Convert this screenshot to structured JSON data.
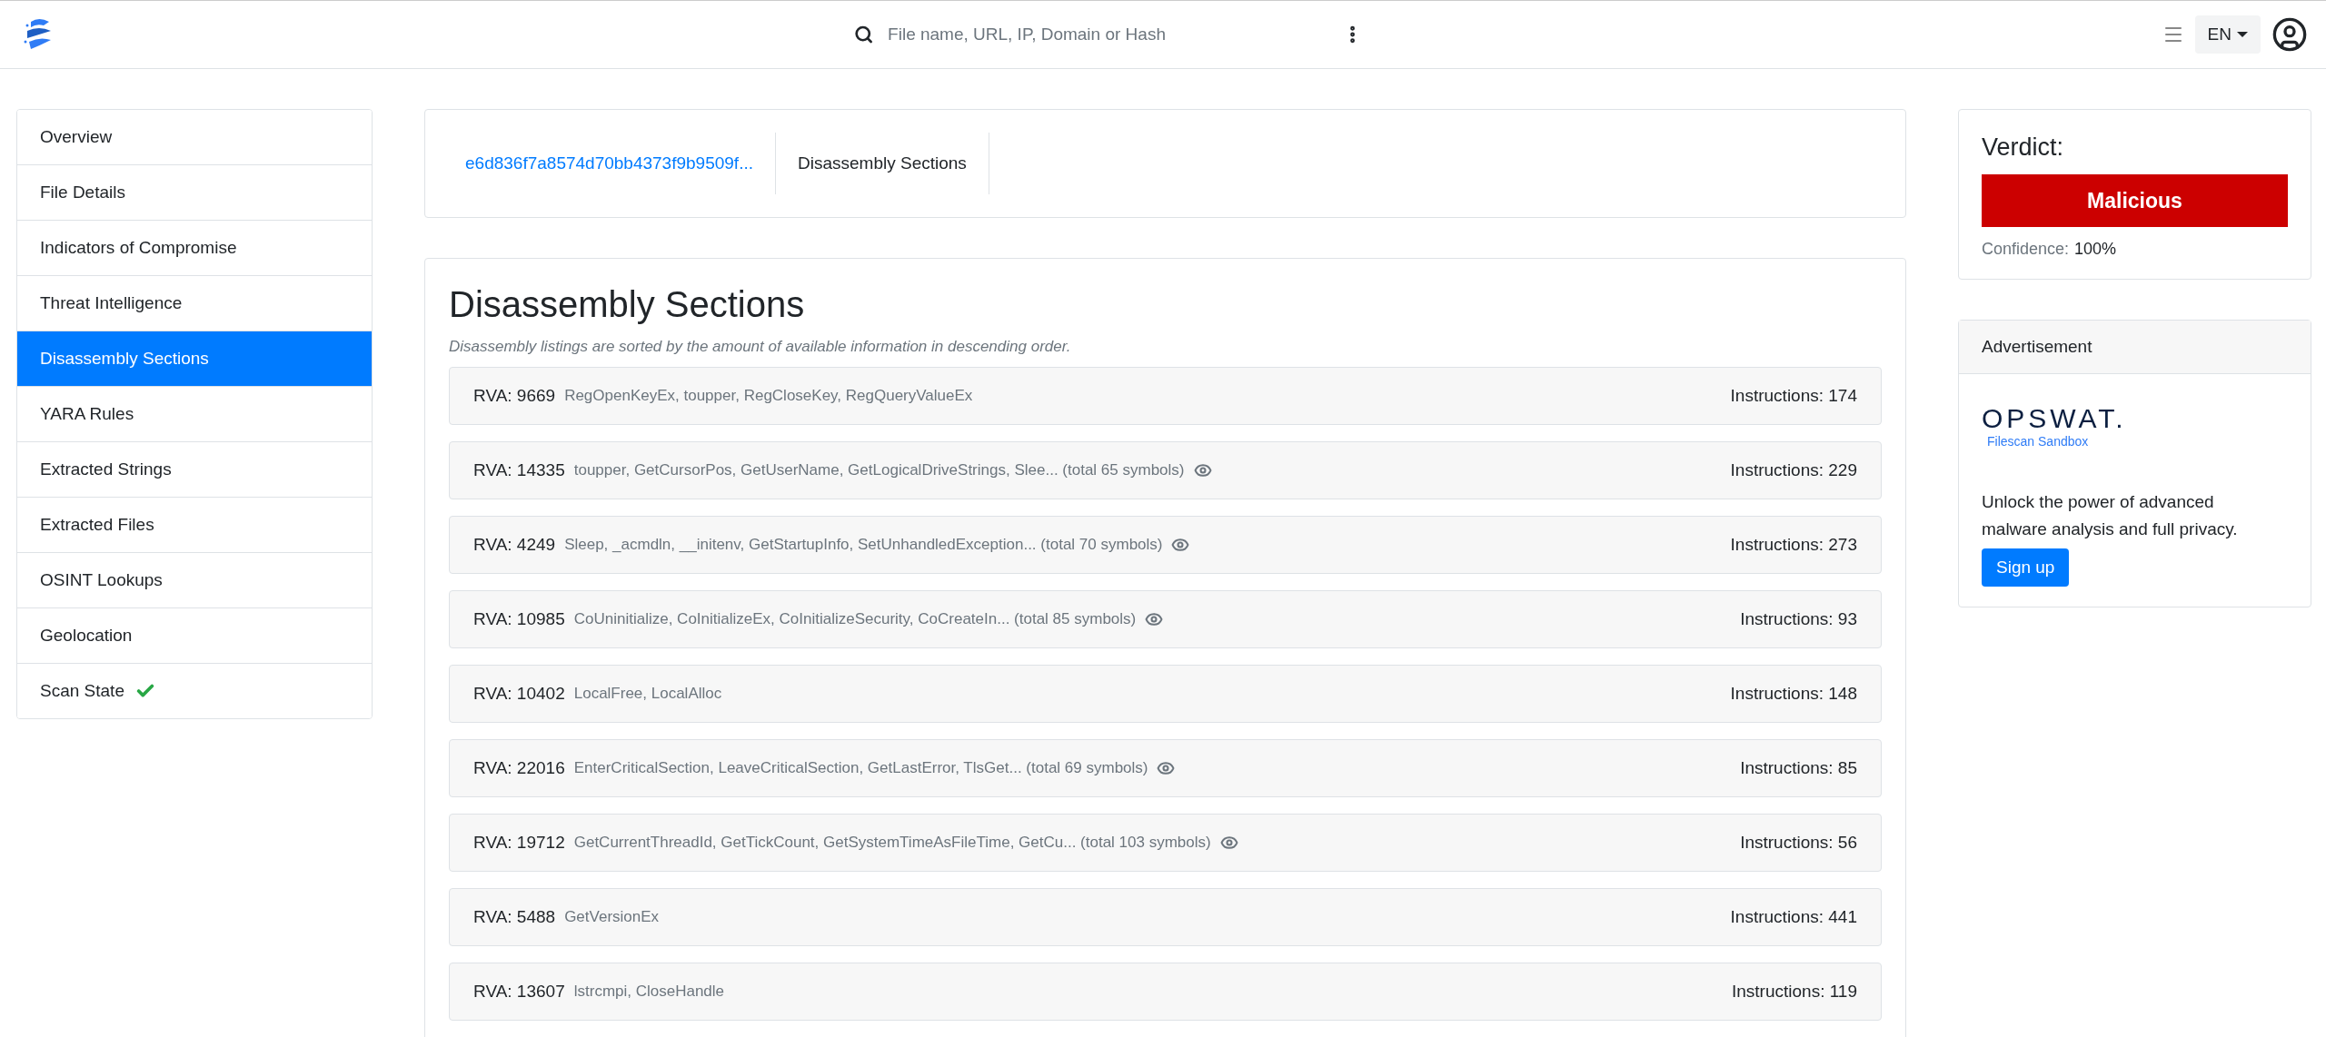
{
  "header": {
    "search": {
      "placeholder": "File name, URL, IP, Domain or Hash"
    },
    "language": "EN"
  },
  "sidebar": {
    "items": [
      {
        "label": "Overview",
        "selected": false,
        "complete": false
      },
      {
        "label": "File Details",
        "selected": false,
        "complete": false
      },
      {
        "label": "Indicators of Compromise",
        "selected": false,
        "complete": false
      },
      {
        "label": "Threat Intelligence",
        "selected": false,
        "complete": false
      },
      {
        "label": "Disassembly Sections",
        "selected": true,
        "complete": false
      },
      {
        "label": "YARA Rules",
        "selected": false,
        "complete": false
      },
      {
        "label": "Extracted Strings",
        "selected": false,
        "complete": false
      },
      {
        "label": "Extracted Files",
        "selected": false,
        "complete": false
      },
      {
        "label": "OSINT Lookups",
        "selected": false,
        "complete": false
      },
      {
        "label": "Geolocation",
        "selected": false,
        "complete": false
      },
      {
        "label": "Scan State",
        "selected": false,
        "complete": true
      }
    ]
  },
  "breadcrumb": [
    {
      "label": "e6d836f7a8574d70bb4373f9b9509f...",
      "kind": "link"
    },
    {
      "label": "Disassembly Sections",
      "kind": "current"
    }
  ],
  "section": {
    "title": "Disassembly Sections",
    "note": "Disassembly listings are sorted by the amount of available information in descending order.",
    "rows": [
      {
        "rva": "RVA: 9669",
        "symbols": "RegOpenKeyEx, toupper, RegCloseKey, RegQueryValueEx",
        "expandable": false,
        "instructions": "Instructions: 174"
      },
      {
        "rva": "RVA: 14335",
        "symbols": "toupper, GetCursorPos, GetUserName, GetLogicalDriveStrings, Slee... (total 65 symbols)",
        "expandable": true,
        "instructions": "Instructions: 229"
      },
      {
        "rva": "RVA: 4249",
        "symbols": "Sleep, _acmdln, __initenv, GetStartupInfo, SetUnhandledException... (total 70 symbols)",
        "expandable": true,
        "instructions": "Instructions: 273"
      },
      {
        "rva": "RVA: 10985",
        "symbols": "CoUninitialize, CoInitializeEx, CoInitializeSecurity, CoCreateIn... (total 85 symbols)",
        "expandable": true,
        "instructions": "Instructions: 93"
      },
      {
        "rva": "RVA: 10402",
        "symbols": "LocalFree, LocalAlloc",
        "expandable": false,
        "instructions": "Instructions: 148"
      },
      {
        "rva": "RVA: 22016",
        "symbols": "EnterCriticalSection, LeaveCriticalSection, GetLastError, TlsGet... (total 69 symbols)",
        "expandable": true,
        "instructions": "Instructions: 85"
      },
      {
        "rva": "RVA: 19712",
        "symbols": "GetCurrentThreadId, GetTickCount, GetSystemTimeAsFileTime, GetCu... (total 103 symbols)",
        "expandable": true,
        "instructions": "Instructions: 56"
      },
      {
        "rva": "RVA: 5488",
        "symbols": "GetVersionEx",
        "expandable": false,
        "instructions": "Instructions: 441"
      },
      {
        "rva": "RVA: 13607",
        "symbols": "lstrcmpi, CloseHandle",
        "expandable": false,
        "instructions": "Instructions: 119"
      }
    ]
  },
  "verdict": {
    "title": "Verdict:",
    "label": "Malicious",
    "color": "#cc0000",
    "confidence_label": "Confidence:",
    "confidence": "100%"
  },
  "advertisement": {
    "title": "Advertisement",
    "brand": "OPSWAT.",
    "product": "Filescan Sandbox",
    "text": "Unlock the power of advanced malware analysis and full privacy.",
    "button": "Sign up"
  }
}
